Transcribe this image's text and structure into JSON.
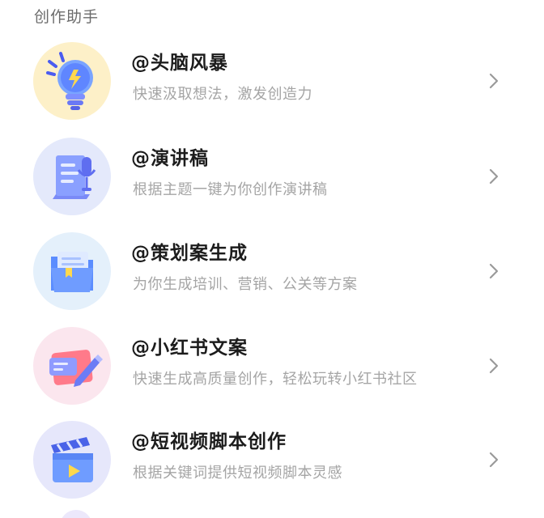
{
  "section": {
    "title": "创作助手"
  },
  "items": [
    {
      "title": "@头脑风暴",
      "desc": "快速汲取想法，激发创造力",
      "icon": "lightbulb-icon",
      "circle_color": "#fdf0c8"
    },
    {
      "title": "@演讲稿",
      "desc": "根据主题一键为你创作演讲稿",
      "icon": "speech-script-icon",
      "circle_color": "#e4e9fb"
    },
    {
      "title": "@策划案生成",
      "desc": "为你生成培训、营销、公关等方案",
      "icon": "folder-plan-icon",
      "circle_color": "#e4f0fb"
    },
    {
      "title": "@小红书文案",
      "desc": "快速生成高质量创作，轻松玩转小红书社区",
      "icon": "note-pen-icon",
      "circle_color": "#fbe6ee"
    },
    {
      "title": "@短视频脚本创作",
      "desc": "根据关键词提供短视频脚本灵感",
      "icon": "clapperboard-icon",
      "circle_color": "#e6e7fb"
    }
  ]
}
